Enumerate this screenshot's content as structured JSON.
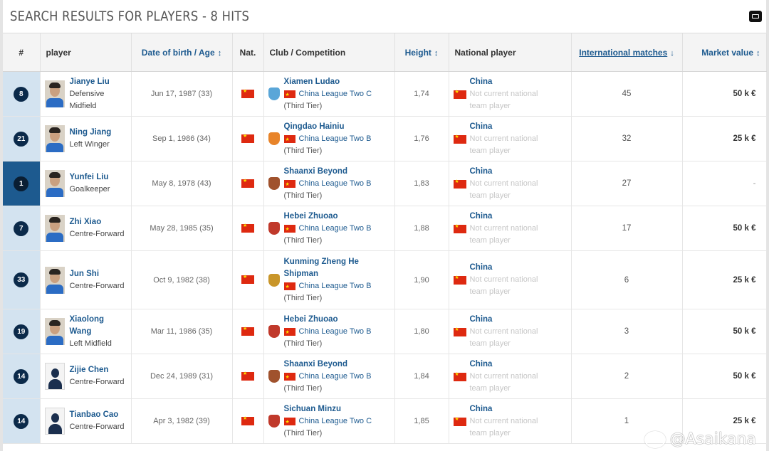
{
  "title": "SEARCH RESULTS FOR PLAYERS - 8 HITS",
  "headers": {
    "num": "#",
    "player": "player",
    "dob": "Date of birth / Age",
    "nat": "Nat.",
    "club": "Club / Competition",
    "height": "Height",
    "national": "National player",
    "intl": "International matches",
    "mv": "Market value"
  },
  "sort_icons": {
    "dob": "↕",
    "height": "↕",
    "intl": "↓",
    "mv": "↕"
  },
  "watermark": "@Asaikana",
  "rows": [
    {
      "num": "8",
      "name": "Jianye Liu",
      "pos": "Defensive Midfield",
      "dob": "Jun 17, 1987 (33)",
      "club": "Xiamen Ludao",
      "comp": "China League Two C",
      "tier": "(Third Tier)",
      "height": "1,74",
      "country": "China",
      "status": "Not current national team player",
      "intl": "45",
      "mv": "50 k €"
    },
    {
      "num": "21",
      "name": "Ning Jiang",
      "pos": "Left Winger",
      "dob": "Sep 1, 1986 (34)",
      "club": "Qingdao Hainiu",
      "comp": "China League Two B",
      "tier": "(Third Tier)",
      "height": "1,76",
      "country": "China",
      "status": "Not current national team player",
      "intl": "32",
      "mv": "25 k €"
    },
    {
      "num": "1",
      "name": "Yunfei Liu",
      "pos": "Goalkeeper",
      "dob": "May 8, 1978 (43)",
      "club": "Shaanxi Beyond",
      "comp": "China League Two B",
      "tier": "(Third Tier)",
      "height": "1,83",
      "country": "China",
      "status": "Not current national team player",
      "intl": "27",
      "mv": "-"
    },
    {
      "num": "7",
      "name": "Zhi Xiao",
      "pos": "Centre-Forward",
      "dob": "May 28, 1985 (35)",
      "club": "Hebei Zhuoao",
      "comp": "China League Two B",
      "tier": "(Third Tier)",
      "height": "1,88",
      "country": "China",
      "status": "Not current national team player",
      "intl": "17",
      "mv": "50 k €"
    },
    {
      "num": "33",
      "name": "Jun Shi",
      "pos": "Centre-Forward",
      "dob": "Oct 9, 1982 (38)",
      "club": "Kunming Zheng He Shipman",
      "comp": "China League Two B",
      "tier": "(Third Tier)",
      "height": "1,90",
      "country": "China",
      "status": "Not current national team player",
      "intl": "6",
      "mv": "25 k €"
    },
    {
      "num": "19",
      "name": "Xiaolong Wang",
      "pos": "Left Midfield",
      "dob": "Mar 11, 1986 (35)",
      "club": "Hebei Zhuoao",
      "comp": "China League Two B",
      "tier": "(Third Tier)",
      "height": "1,80",
      "country": "China",
      "status": "Not current national team player",
      "intl": "3",
      "mv": "50 k €"
    },
    {
      "num": "14",
      "name": "Zijie Chen",
      "pos": "Centre-Forward",
      "dob": "Dec 24, 1989 (31)",
      "club": "Shaanxi Beyond",
      "comp": "China League Two B",
      "tier": "(Third Tier)",
      "height": "1,84",
      "country": "China",
      "status": "Not current national team player",
      "intl": "2",
      "mv": "50 k €"
    },
    {
      "num": "14",
      "name": "Tianbao Cao",
      "pos": "Centre-Forward",
      "dob": "Apr 3, 1982 (39)",
      "club": "Sichuan Minzu",
      "comp": "China League Two C",
      "tier": "(Third Tier)",
      "height": "1,85",
      "country": "China",
      "status": "Not current national team player",
      "intl": "1",
      "mv": "25 k €"
    }
  ]
}
